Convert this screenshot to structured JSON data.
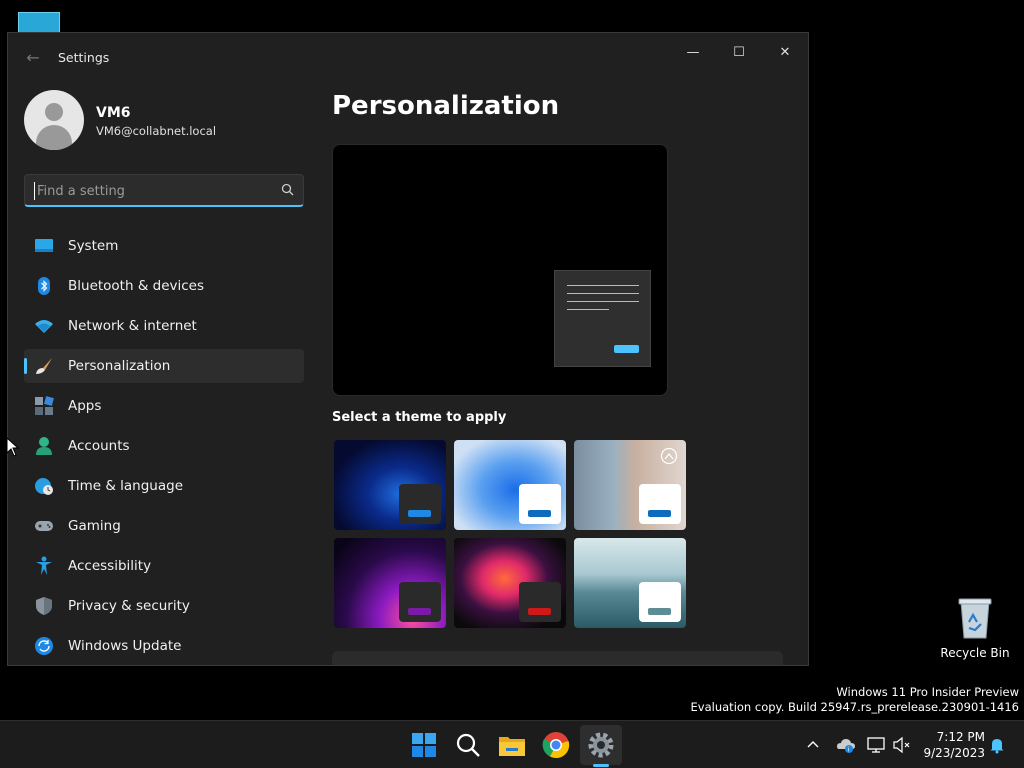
{
  "window": {
    "title": "Settings",
    "back_glyph": "←",
    "minimize_glyph": "—",
    "maximize_glyph": "☐",
    "close_glyph": "✕"
  },
  "user": {
    "name": "VM6",
    "email": "VM6@collabnet.local"
  },
  "search": {
    "placeholder": "Find a setting",
    "value": ""
  },
  "sidebar": {
    "items": [
      {
        "label": "System",
        "icon": "system-icon",
        "active": false
      },
      {
        "label": "Bluetooth & devices",
        "icon": "bluetooth-icon",
        "active": false
      },
      {
        "label": "Network & internet",
        "icon": "wifi-icon",
        "active": false
      },
      {
        "label": "Personalization",
        "icon": "brush-icon",
        "active": true
      },
      {
        "label": "Apps",
        "icon": "apps-icon",
        "active": false
      },
      {
        "label": "Accounts",
        "icon": "accounts-icon",
        "active": false
      },
      {
        "label": "Time & language",
        "icon": "time-language-icon",
        "active": false
      },
      {
        "label": "Gaming",
        "icon": "gamepad-icon",
        "active": false
      },
      {
        "label": "Accessibility",
        "icon": "accessibility-icon",
        "active": false
      },
      {
        "label": "Privacy & security",
        "icon": "shield-icon",
        "active": false
      },
      {
        "label": "Windows Update",
        "icon": "update-icon",
        "active": false
      }
    ]
  },
  "main": {
    "title": "Personalization",
    "theme_section_label": "Select a theme to apply",
    "themes": [
      {
        "name": "windows-dark",
        "button_color": "#1e88e5"
      },
      {
        "name": "windows-light",
        "button_color": "#0f6cbd"
      },
      {
        "name": "windows-spotlight",
        "button_color": "#0f6cbd"
      },
      {
        "name": "glow",
        "button_color": "#7a1aa6"
      },
      {
        "name": "captured-motion",
        "button_color": "#d11818"
      },
      {
        "name": "flow",
        "button_color": "#5c8c96"
      }
    ]
  },
  "desktop": {
    "recycle_bin_label": "Recycle Bin",
    "watermark_line1": "Windows 11 Pro Insider Preview",
    "watermark_line2": "Evaluation copy. Build 25947.rs_prerelease.230901-1416"
  },
  "taskbar": {
    "apps": [
      "start-icon",
      "search-icon",
      "file-explorer-icon",
      "chrome-icon",
      "settings-icon"
    ],
    "tray_chevron": "^",
    "time": "7:12 PM",
    "date": "9/23/2023"
  },
  "colors": {
    "accent": "#4cc2ff",
    "window_bg": "#202020",
    "taskbar_bg": "#1c1c1c"
  }
}
